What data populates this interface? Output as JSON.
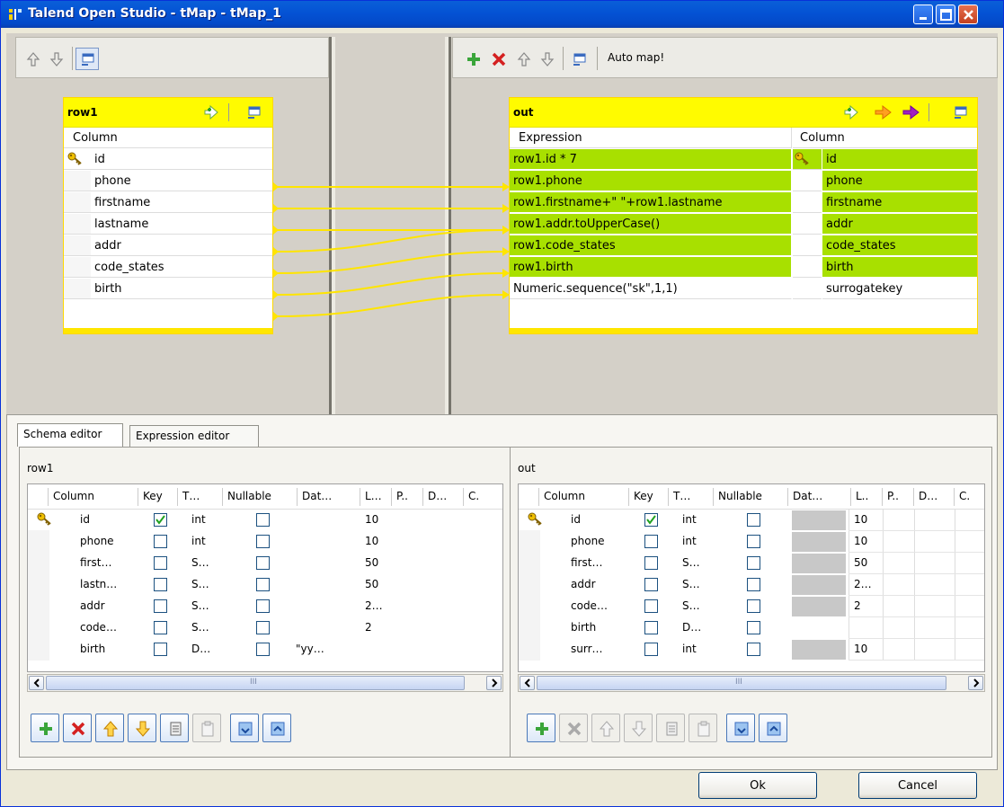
{
  "window": {
    "title": "Talend Open Studio - tMap - tMap_1"
  },
  "left_toolbar": {
    "icons": [
      "up-arrow-icon",
      "down-arrow-icon",
      "minimize-icon"
    ]
  },
  "right_toolbar": {
    "auto_map": "Auto map!"
  },
  "input_table": {
    "name": "row1",
    "header": "Column",
    "rows": [
      "id",
      "phone",
      "firstname",
      "lastname",
      "addr",
      "code_states",
      "birth"
    ]
  },
  "output_table": {
    "name": "out",
    "expr_header": "Expression",
    "col_header": "Column",
    "rows": [
      {
        "expr": "row1.id * 7",
        "col": "id"
      },
      {
        "expr": "row1.phone",
        "col": "phone"
      },
      {
        "expr": "row1.firstname+\" \"+row1.lastname",
        "col": "firstname"
      },
      {
        "expr": "row1.addr.toUpperCase()",
        "col": "addr"
      },
      {
        "expr": "row1.code_states",
        "col": "code_states"
      },
      {
        "expr": "row1.birth",
        "col": "birth"
      },
      {
        "expr": "Numeric.sequence(\"sk\",1,1)",
        "col": "surrogatekey"
      }
    ]
  },
  "tabs": [
    "Schema editor",
    "Expression editor"
  ],
  "schema_left": {
    "title": "row1",
    "headers": [
      "Column",
      "Key",
      "T…",
      "Nullable",
      "Dat…",
      "L…",
      "P..",
      "D…",
      "C."
    ],
    "rows": [
      {
        "col": "id",
        "key": true,
        "type": "int",
        "date": "",
        "len": "10"
      },
      {
        "col": "phone",
        "key": false,
        "type": "int",
        "date": "",
        "len": "10"
      },
      {
        "col": "first…",
        "key": false,
        "type": "S…",
        "date": "",
        "len": "50"
      },
      {
        "col": "lastn…",
        "key": false,
        "type": "S…",
        "date": "",
        "len": "50"
      },
      {
        "col": "addr",
        "key": false,
        "type": "S…",
        "date": "",
        "len": "2…"
      },
      {
        "col": "code…",
        "key": false,
        "type": "S…",
        "date": "",
        "len": "2"
      },
      {
        "col": "birth",
        "key": false,
        "type": "D…",
        "date": "\"yy…",
        "len": ""
      }
    ],
    "scroll_grip": "III"
  },
  "schema_right": {
    "title": "out",
    "headers": [
      "Column",
      "Key",
      "T…",
      "Nullable",
      "Dat…",
      "L..",
      "P..",
      "D…",
      "C."
    ],
    "rows": [
      {
        "col": "id",
        "key": true,
        "type": "int",
        "len": "10"
      },
      {
        "col": "phone",
        "key": false,
        "type": "int",
        "len": "10"
      },
      {
        "col": "first…",
        "key": false,
        "type": "S…",
        "len": "50"
      },
      {
        "col": "addr",
        "key": false,
        "type": "S…",
        "len": "2…"
      },
      {
        "col": "code…",
        "key": false,
        "type": "S…",
        "len": "2"
      },
      {
        "col": "birth",
        "key": false,
        "type": "D…",
        "len": ""
      },
      {
        "col": "surr…",
        "key": false,
        "type": "int",
        "len": "10"
      }
    ],
    "scroll_grip": "III"
  },
  "buttons": {
    "ok": "Ok",
    "cancel": "Cancel"
  }
}
